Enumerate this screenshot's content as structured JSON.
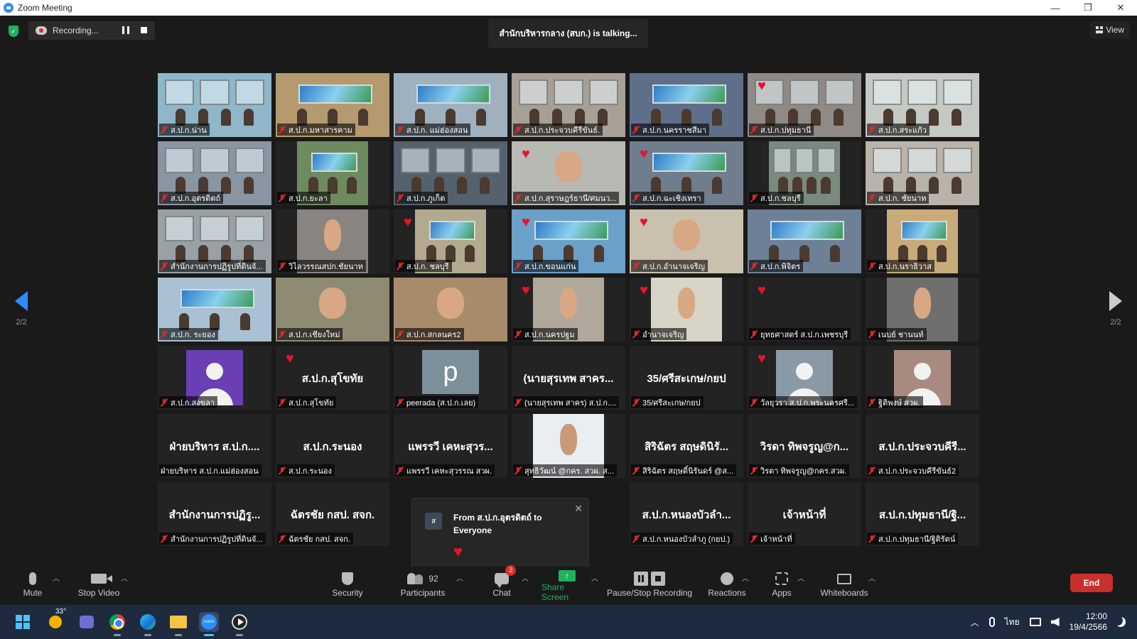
{
  "window": {
    "title": "Zoom Meeting",
    "controls": [
      "—",
      "❐",
      "✕"
    ]
  },
  "top_bar": {
    "recording_label": "Recording...",
    "talking_indicator": "สำนักบริหารกลาง (สบก.) is talking...",
    "view_label": "View"
  },
  "pagination": {
    "prev_page": "2/2",
    "next_page": "2/2"
  },
  "tiles": [
    {
      "name": "ส.ป.ก.น่าน",
      "kind": "video",
      "scene": "office",
      "tone": "#8fb6c9"
    },
    {
      "name": "ส.ป.ก.มหาสารคาม",
      "kind": "video",
      "scene": "banner",
      "tone": "#b49a6e"
    },
    {
      "name": "ส.ป.ก. แม่ฮ่องสอน",
      "kind": "video",
      "scene": "banner",
      "tone": "#9fb1bf"
    },
    {
      "name": "ส.ป.ก.ประจวบคีรีขันธ์.",
      "kind": "video",
      "scene": "office",
      "tone": "#a7a097"
    },
    {
      "name": "ส.ป.ก.นครราชสีมา",
      "kind": "video",
      "scene": "banner",
      "tone": "#5f6f8a"
    },
    {
      "name": "ส.ป.ก.ปทุมธานี",
      "kind": "video",
      "scene": "office",
      "tone": "#8f8a86",
      "heart": true
    },
    {
      "name": "ส.ป.ก.สระแก้ว",
      "kind": "video",
      "scene": "office",
      "tone": "#c4c9c4"
    },
    {
      "name": "ส.ป.ก.อุตรดิตถ์",
      "kind": "video",
      "scene": "office",
      "tone": "#8a95a3"
    },
    {
      "name": "ส.ป.ก.ยะลา",
      "kind": "video",
      "scene": "banner",
      "tone": "#6e8b5f",
      "narrow": true
    },
    {
      "name": "ส.ป.ก.ภูเก็ต",
      "kind": "video",
      "scene": "office",
      "tone": "#55616d"
    },
    {
      "name": "ส.ป.ก.สุราษฎร์ธานี/ศมนว...",
      "kind": "video",
      "scene": "face",
      "tone": "#b7b9b2",
      "heart": true
    },
    {
      "name": "ส.ป.ก.ฉะเชิงเทรา",
      "kind": "video",
      "scene": "banner",
      "tone": "#6f7d8c",
      "heart": true
    },
    {
      "name": "ส.ป.ก.ชลบุรี",
      "kind": "video",
      "scene": "office",
      "tone": "#7b8a7f",
      "narrow": true
    },
    {
      "name": "ส.ป.ก. ชัยนาท",
      "kind": "video",
      "scene": "office",
      "tone": "#b9b3aa"
    },
    {
      "name": "สำนักงานการปฏิรูปที่ดินจั...",
      "kind": "video",
      "scene": "office",
      "tone": "#9aa1a6"
    },
    {
      "name": "วิไลวรรณสปก.ชัยนาท",
      "kind": "video",
      "scene": "face",
      "tone": "#8a8480",
      "narrow": true
    },
    {
      "name": "ส.ป.ก. ชลบุรี",
      "kind": "video",
      "scene": "banner",
      "tone": "#b2a98e",
      "narrow": true,
      "heart": true
    },
    {
      "name": "ส.ป.ก.ขอนแก่น",
      "kind": "video",
      "scene": "banner",
      "tone": "#6ba0c8",
      "heart": true
    },
    {
      "name": "ส.ป.ก.อำนาจเจริญ",
      "kind": "video",
      "scene": "face",
      "tone": "#c9c0ad",
      "heart": true
    },
    {
      "name": "ส.ป.ก.พิจิตร",
      "kind": "video",
      "scene": "banner",
      "tone": "#6e8096"
    },
    {
      "name": "ส.ป.ก.นราธิวาส",
      "kind": "video",
      "scene": "banner",
      "tone": "#c9ab7a",
      "narrow": true
    },
    {
      "name": "ส.ป.ก. ระยอง",
      "kind": "video",
      "scene": "banner",
      "tone": "#a9c1d3"
    },
    {
      "name": "ส.ป.ก.เชียงใหม่",
      "kind": "video",
      "scene": "face",
      "tone": "#8f8a72"
    },
    {
      "name": "ส.ป.ก.สกลนคร2",
      "kind": "video",
      "scene": "face",
      "tone": "#a88b6b"
    },
    {
      "name": "ส.ป.ก.นครปฐม",
      "kind": "video",
      "scene": "face",
      "tone": "#b1a89c",
      "narrow": true,
      "heart": true
    },
    {
      "name": "อำนาจเจริญ",
      "kind": "video",
      "scene": "face",
      "tone": "#d8d4c8",
      "narrow": true,
      "heart": true
    },
    {
      "name": "ยุทธศาสตร์ ส.ป.ก.เพชรบุรี",
      "kind": "empty",
      "heart": true
    },
    {
      "name": "เนบย์ ชานนท์",
      "kind": "video",
      "scene": "face",
      "tone": "#6f6f6f",
      "narrow": true
    },
    {
      "name": "ส.ป.ก.สงขลา",
      "kind": "avatar",
      "color": "#6a3fb5"
    },
    {
      "name": "ส.ป.ก.สุโขทัย",
      "kind": "text",
      "display": "ส.ป.ก.สุโขทัย",
      "heart": true
    },
    {
      "name": "peerada (ส.ป.ก.เลย)",
      "kind": "letter",
      "display": "p"
    },
    {
      "name": "(นายสุรเทพ สาคร) ส.ป.ก....",
      "kind": "text",
      "display": "(นายสุรเทพ สาคร..."
    },
    {
      "name": "35/ศรีสะเกษ/กยป",
      "kind": "text",
      "display": "35/ศรีสะเกษ/กยป"
    },
    {
      "name": "วัลยุวรา ส.ป.ก.พระนครศรี...",
      "kind": "avatar",
      "color": "#8a99a6",
      "heart": true
    },
    {
      "name": "ฐิติพงษ์ สวผ.",
      "kind": "avatar",
      "color": "#a88a80"
    },
    {
      "name": "ฝ่ายบริหาร ส.ป.ก.แม่ฮ่องสอน",
      "kind": "text",
      "display": "ฝ่ายบริหาร ส.ป.ก....",
      "no_mic": true
    },
    {
      "name": "ส.ป.ก.ระนอง",
      "kind": "text",
      "display": "ส.ป.ก.ระนอง"
    },
    {
      "name": "แพรรวี เคหะสุวรรณ สวผ.",
      "kind": "text",
      "display": "แพรรวี เคหะสุวร..."
    },
    {
      "name": "สุทธิวัฒน์ @กคร. สวผ. ส...",
      "kind": "video",
      "scene": "portrait",
      "tone": "#e9eef2",
      "narrow": true
    },
    {
      "name": "สิริฉัตร สฤษดิ์นิรันดร์ @ส...",
      "kind": "text",
      "display": "สิริฉัตร สฤษดินิรั..."
    },
    {
      "name": "วิรดา ทิพจรูญ@กคร.สวผ.",
      "kind": "text",
      "display": "วิรดา ทิพจรูญ@ก..."
    },
    {
      "name": "ส.ป.ก.ประจวบคีรีขันธ์2",
      "kind": "text",
      "display": "ส.ป.ก.ประจวบคีรี..."
    },
    {
      "name": "สำนักงานการปฏิรูปที่ดินจั...",
      "kind": "text",
      "display": "สำนักงานการปฏิรู..."
    },
    {
      "name": "ฉัตรชัย กสป. สจก.",
      "kind": "text",
      "display": "ฉัตรชัย กสป. สจก."
    },
    {
      "name": "",
      "kind": "hidden"
    },
    {
      "name": "",
      "kind": "hidden"
    },
    {
      "name": "ส.ป.ก.หนองบัวลำภู (กยป.)",
      "kind": "text",
      "display": "ส.ป.ก.หนองบัวลำ..."
    },
    {
      "name": "เจ้าหน้าที่",
      "kind": "text",
      "display": "เจ้าหน้าที่"
    },
    {
      "name": "ส.ป.ก.ปทุมธานี/ฐิติรัตน์",
      "kind": "text",
      "display": "ส.ป.ก.ปทุมธานี/ฐิ..."
    }
  ],
  "chat_popup": {
    "from": "From ส.ป.ก.อุตรดิตถ์ to Everyone",
    "message": "♥",
    "icon_text": "ส"
  },
  "toolbar": {
    "mute": "Mute",
    "stop_video": "Stop Video",
    "security": "Security",
    "participants": "Participants",
    "participants_count": "92",
    "chat": "Chat",
    "chat_badge": "3",
    "share_screen": "Share Screen",
    "pause_stop_recording": "Pause/Stop Recording",
    "reactions": "Reactions",
    "apps": "Apps",
    "whiteboards": "Whiteboards",
    "end": "End"
  },
  "taskbar": {
    "weather_temp": "33°",
    "language": "ไทย",
    "time": "12:00",
    "date": "19/4/2566"
  },
  "colors": {
    "zoom_blue": "#2d8cff",
    "share_green": "#21b35c",
    "end_red": "#c9302c",
    "reaction_red": "#e8142c"
  }
}
